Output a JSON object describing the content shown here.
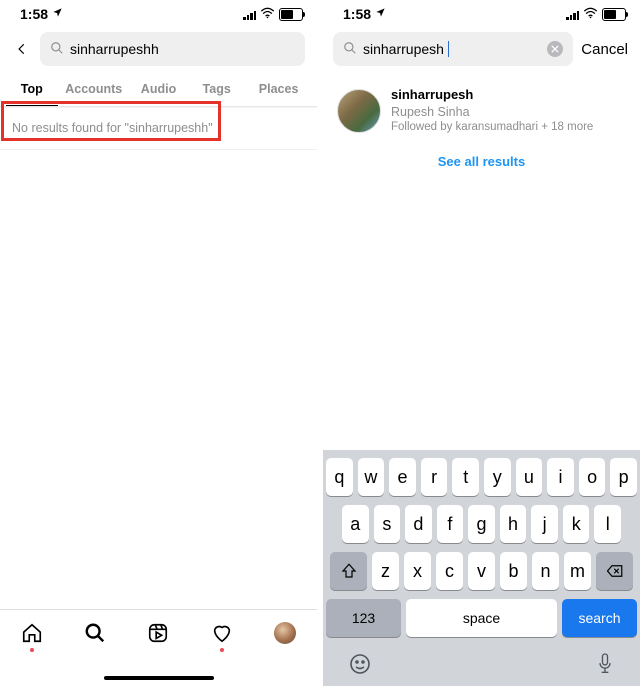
{
  "status": {
    "time": "1:58",
    "signal": "signal",
    "wifi": "wifi",
    "battery": "55"
  },
  "left": {
    "search_value": "sinharrupeshh",
    "tabs": [
      "Top",
      "Accounts",
      "Audio",
      "Tags",
      "Places"
    ],
    "active_tab": 0,
    "no_results": "No results found for \"sinharrupeshh\""
  },
  "right": {
    "search_value": "sinharrupesh",
    "cancel": "Cancel",
    "result": {
      "username": "sinharrupesh",
      "fullname": "Rupesh Sinha",
      "followed": "Followed by karansumadhari + 18 more"
    },
    "see_all": "See all results",
    "keyboard": {
      "row1": [
        "q",
        "w",
        "e",
        "r",
        "t",
        "y",
        "u",
        "i",
        "o",
        "p"
      ],
      "row2": [
        "a",
        "s",
        "d",
        "f",
        "g",
        "h",
        "j",
        "k",
        "l"
      ],
      "row3": [
        "z",
        "x",
        "c",
        "v",
        "b",
        "n",
        "m"
      ],
      "k123": "123",
      "space": "space",
      "search": "search"
    }
  }
}
